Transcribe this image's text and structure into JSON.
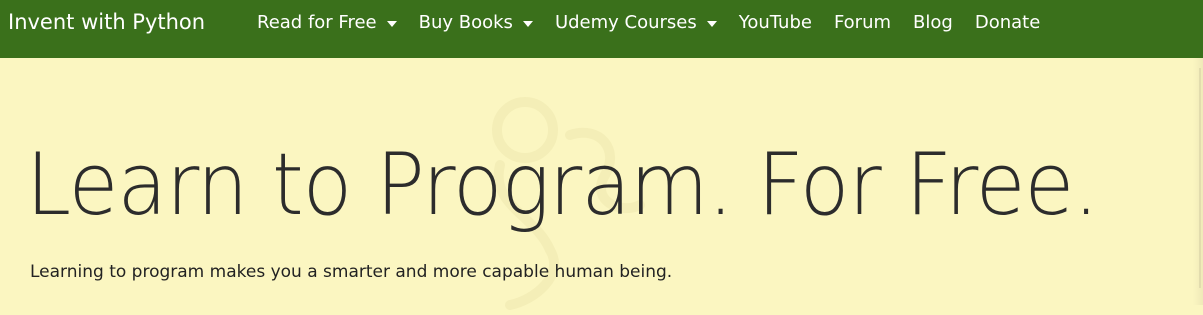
{
  "navbar": {
    "brand": "Invent with Python",
    "items": [
      {
        "label": "Read for Free",
        "has_dropdown": true
      },
      {
        "label": "Buy Books",
        "has_dropdown": true
      },
      {
        "label": "Udemy Courses",
        "has_dropdown": true
      },
      {
        "label": "YouTube",
        "has_dropdown": false
      },
      {
        "label": "Forum",
        "has_dropdown": false
      },
      {
        "label": "Blog",
        "has_dropdown": false
      },
      {
        "label": "Donate",
        "has_dropdown": false
      }
    ]
  },
  "hero": {
    "title": "Learn to Program. For Free.",
    "subtitle": "Learning to program makes you a smarter and more capable human being."
  },
  "colors": {
    "navbar_bg": "#3a701b",
    "page_bg": "#fbf6c1",
    "nav_text": "#ffffff",
    "title_text": "#2c2c2c"
  }
}
